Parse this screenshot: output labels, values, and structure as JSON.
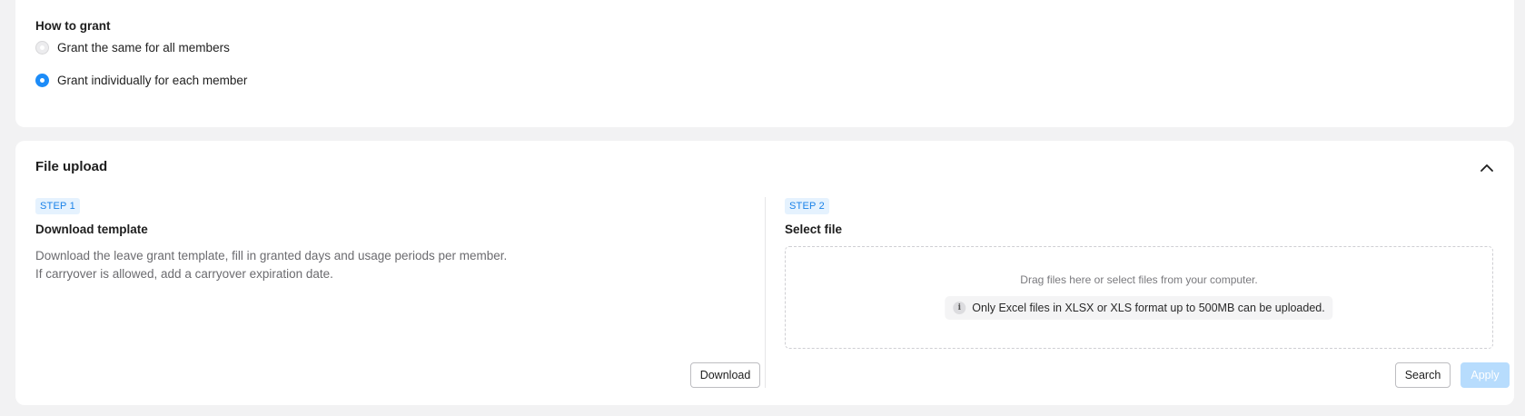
{
  "grant": {
    "section_label": "How to grant",
    "options": [
      {
        "label": "Grant the same for all members",
        "checked": false
      },
      {
        "label": "Grant individually for each member",
        "checked": true
      }
    ]
  },
  "upload": {
    "title": "File upload",
    "collapse_icon": "chevron-up-icon",
    "step1": {
      "badge": "STEP 1",
      "title": "Download template",
      "desc_line1": "Download the leave grant template, fill in granted days and usage periods per member.",
      "desc_line2": "If carryover is allowed, add a carryover expiration date.",
      "download_label": "Download"
    },
    "step2": {
      "badge": "STEP 2",
      "title": "Select file",
      "drop_text": "Drag files here or select files from your computer.",
      "info_icon": "info-icon",
      "note": "Only Excel files in XLSX or XLS format up to 500MB can be uploaded.",
      "search_label": "Search",
      "apply_label": "Apply",
      "apply_disabled": true
    }
  },
  "colors": {
    "accent": "#1d8cf8",
    "badge_bg": "#e5f2fe",
    "apply_disabled_bg": "#b7dcfd"
  }
}
